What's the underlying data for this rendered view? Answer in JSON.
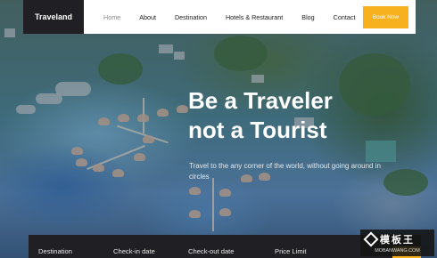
{
  "brand": {
    "logo_text": "Traveland"
  },
  "nav": {
    "items": [
      {
        "label": "Home",
        "active": true
      },
      {
        "label": "About",
        "active": false
      },
      {
        "label": "Destination",
        "active": false
      },
      {
        "label": "Hotels & Restaurant",
        "active": false
      },
      {
        "label": "Blog",
        "active": false
      },
      {
        "label": "Contact",
        "active": false
      }
    ],
    "cta_label": "Book Now"
  },
  "hero": {
    "title_line1": "Be a Traveler",
    "title_line2": "not a Tourist",
    "subtitle": "Travel to the any corner of the world, without going around in circles"
  },
  "search": {
    "fields": [
      "Destination",
      "Check-in date",
      "Check-out date",
      "Price Limit"
    ]
  },
  "watermark": {
    "top": "模板王",
    "bottom": "MOBANWANG.COM"
  },
  "colors": {
    "accent": "#f7b11e",
    "dark": "#1f1f24",
    "white": "#ffffff"
  }
}
